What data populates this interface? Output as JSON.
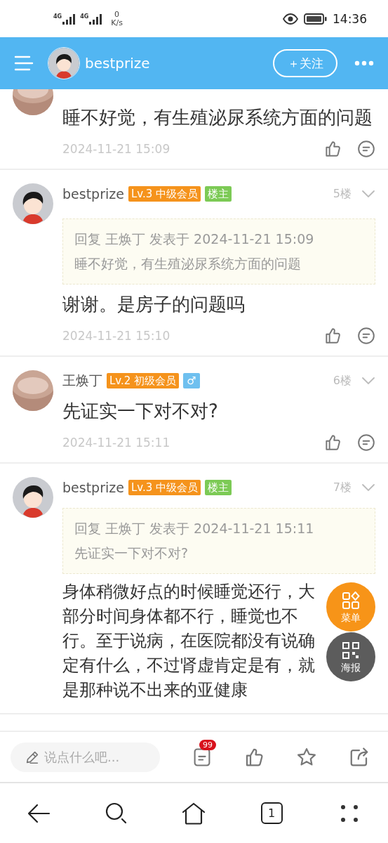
{
  "status_bar": {
    "network_labels": [
      "4G",
      "4G"
    ],
    "speed": "0",
    "speed_unit": "K/s",
    "time": "14:36"
  },
  "header": {
    "title": "bestprize",
    "follow_button": "＋关注"
  },
  "posts": [
    {
      "partial": true,
      "avatar": {
        "kind": "photo"
      },
      "content": "睡不好觉，有生殖泌尿系统方面的问题",
      "date": "2024-11-21 15:09"
    },
    {
      "partial": false,
      "avatar": {
        "kind": "cartoon"
      },
      "name": "bestprize",
      "badges": [
        {
          "kind": "level",
          "text": "Lv.3 中级会员"
        },
        {
          "kind": "owner",
          "text": "楼主"
        }
      ],
      "floor": "5楼",
      "quote": {
        "header": "回复 王焕丁 发表于 2024-11-21 15:09",
        "text": "睡不好觉，有生殖泌尿系统方面的问题"
      },
      "content": "谢谢。是房子的问题吗",
      "date": "2024-11-21 15:10"
    },
    {
      "partial": false,
      "avatar": {
        "kind": "photo"
      },
      "name": "王焕丁",
      "badges": [
        {
          "kind": "level",
          "text": "Lv.2 初级会员"
        },
        {
          "kind": "gender",
          "text": "♂"
        }
      ],
      "floor": "6楼",
      "content": "先证实一下对不对?",
      "date": "2024-11-21 15:11"
    },
    {
      "partial": false,
      "avatar": {
        "kind": "cartoon"
      },
      "name": "bestprize",
      "badges": [
        {
          "kind": "level",
          "text": "Lv.3 中级会员"
        },
        {
          "kind": "owner",
          "text": "楼主"
        }
      ],
      "floor": "7楼",
      "quote": {
        "header": "回复 王焕丁 发表于 2024-11-21 15:11",
        "text": "先证实一下对不对?"
      },
      "content": "身体稍微好点的时候睡觉还行，大部分时间身体都不行，睡觉也不行。至于说病，在医院都没有说确定有什么，不过肾虚肯定是有，就是那种说不出来的亚健康"
    }
  ],
  "floating_buttons": [
    {
      "kind": "menu",
      "label": "菜单"
    },
    {
      "kind": "poster",
      "label": "海报"
    }
  ],
  "action_bar": {
    "placeholder": "说点什么吧...",
    "comment_count": "99"
  },
  "nav_bar": [
    {
      "kind": "back"
    },
    {
      "kind": "search"
    },
    {
      "kind": "home"
    },
    {
      "kind": "tabs",
      "label": "1"
    },
    {
      "kind": "more"
    }
  ]
}
